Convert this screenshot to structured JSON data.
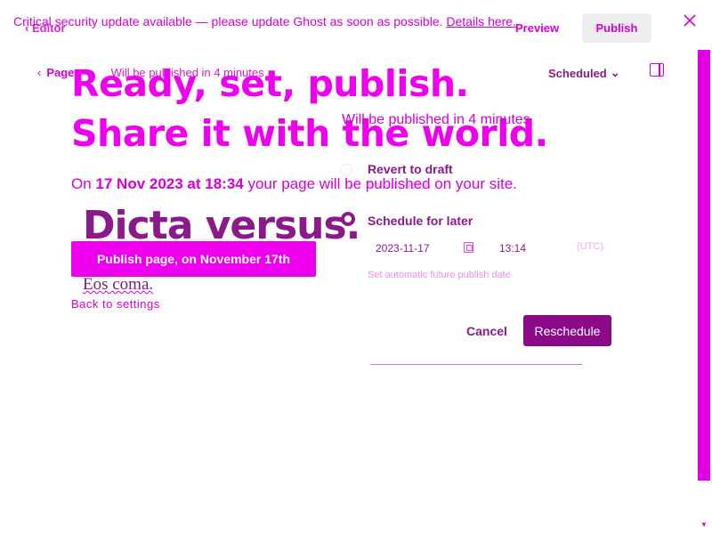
{
  "banner": {
    "message": "Critical security update available — please update Ghost as soon as possible.",
    "link": "Details here."
  },
  "topbar": {
    "back_label": "Editor",
    "preview_label": "Preview",
    "publish_label": "Publish"
  },
  "breadcrumb": {
    "parent": "Pages",
    "status": "Will be published in 4 minutes"
  },
  "status_dropdown": {
    "value": "Scheduled"
  },
  "hero": {
    "line1": "Ready, set, publish.",
    "line2": "Share it with the world.",
    "sub_prefix": "On ",
    "sub_date": "17 Nov 2023 at 18:34",
    "sub_suffix": " your page will be published on your site."
  },
  "post": {
    "title": "Dicta versus.",
    "body": "Eos coma."
  },
  "publish_button": {
    "label": "Publish page, on November 17th"
  },
  "back_to_settings": "Back to settings",
  "schedule_dialog": {
    "title": "Will be published in 4 minutes",
    "revert_label": "Revert to draft",
    "revert_sub": "Do not publish",
    "schedule_label": "Schedule for later",
    "date_value": "2023-11-17",
    "time_value": "13:14",
    "timezone": "(UTC)",
    "hint": "Set automatic future publish date",
    "cancel_label": "Cancel",
    "reschedule_label": "Reschedule"
  },
  "colors": {
    "accent": "#ee00ee",
    "dark_accent": "#8a0a8a",
    "text_magenta": "#d400d4"
  },
  "icons": {
    "back": "chevron-left-icon",
    "close": "close-icon",
    "dropdown": "chevron-down-icon",
    "sidebar": "sidebar-toggle-icon",
    "calendar": "calendar-icon"
  }
}
